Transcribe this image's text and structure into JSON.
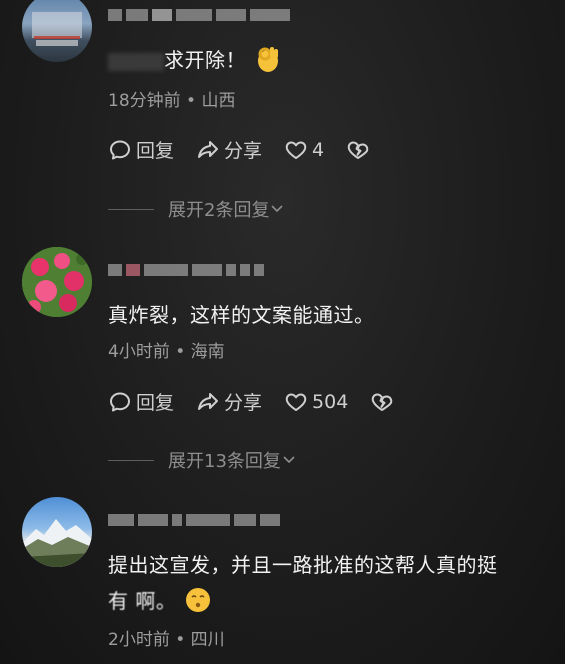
{
  "comments": [
    {
      "text": "求开除！",
      "meta": "18分钟前 • 山西",
      "reply_label": "回复",
      "share_label": "分享",
      "like_count": "4",
      "expand_label": "展开2条回复"
    },
    {
      "text": "真炸裂，这样的文案能通过。",
      "meta": "4小时前 • 海南",
      "reply_label": "回复",
      "share_label": "分享",
      "like_count": "504",
      "expand_label": "展开13条回复"
    },
    {
      "text_line1": "提出这宣发，并且一路批准的这帮人真的挺",
      "text_line2": "有 啊。",
      "meta": "2小时前 • 四川"
    }
  ],
  "icons": {
    "reply": "speech-bubble-icon",
    "share": "share-arrow-icon",
    "like": "heart-icon",
    "dislike": "broken-heart-icon",
    "ok_emoji": "ok-hand-emoji",
    "face_emoji": "smirk-face-emoji"
  }
}
